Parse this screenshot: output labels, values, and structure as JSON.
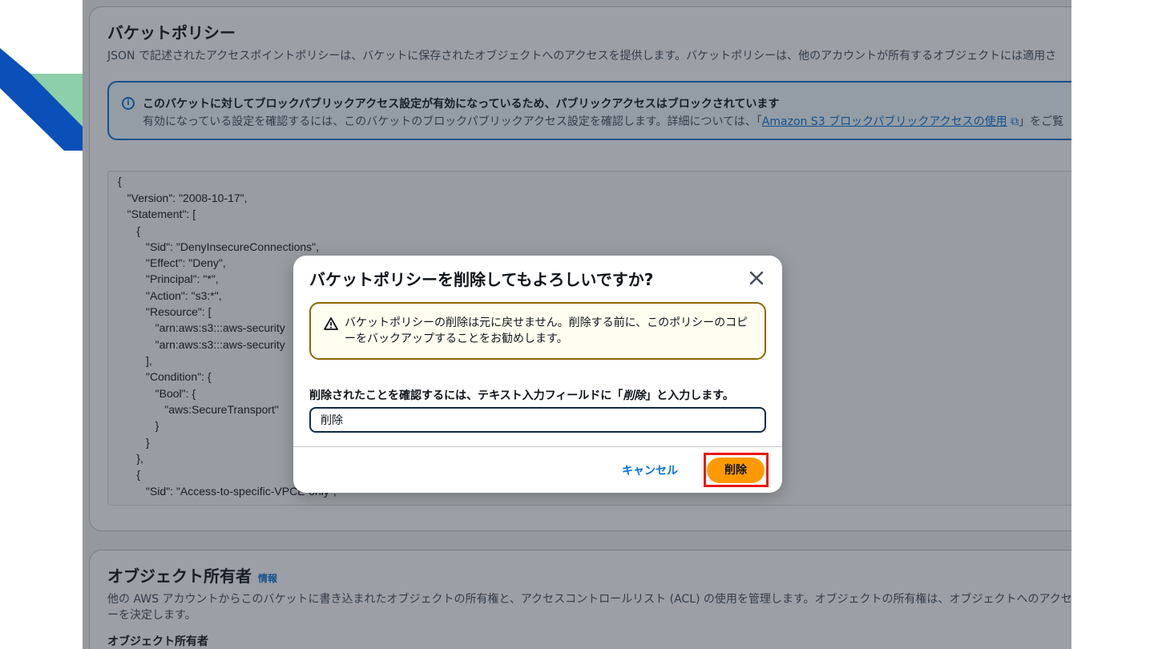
{
  "policy": {
    "title": "バケットポリシー",
    "description": "JSON で記述されたアクセスポイントポリシーは、バケットに保存されたオブジェクトへのアクセスを提供します。バケットポリシーは、他のアカウントが所有するオブジェクトには適用さ",
    "alert": {
      "heading": "このバケットに対してブロックパブリックアクセス設定が有効になっているため、パブリックアクセスはブロックされています",
      "body_prefix": "有効になっている設定を確認するには、このバケットのブロックパブリックアクセス設定を確認します。詳細については、「",
      "link": "Amazon S3 ブロックパブリックアクセスの使用",
      "body_suffix": "」をご覧"
    },
    "code_lines": [
      "{",
      "   \"Version\": \"2008-10-17\",",
      "   \"Statement\": [",
      "      {",
      "         \"Sid\": \"DenyInsecureConnections\",",
      "         \"Effect\": \"Deny\",",
      "         \"Principal\": \"*\",",
      "         \"Action\": \"s3:*\",",
      "         \"Resource\": [",
      "            \"arn:aws:s3:::aws-security",
      "            \"arn:aws:s3:::aws-security",
      "         ],",
      "         \"Condition\": {",
      "            \"Bool\": {",
      "               \"aws:SecureTransport\"",
      "            }",
      "         }",
      "      },",
      "      {",
      "         \"Sid\": \"Access-to-specific-VPCE-only\","
    ]
  },
  "owner": {
    "title": "オブジェクト所有者",
    "info": "情報",
    "description_line1": "他の AWS アカウントからこのバケットに書き込まれたオブジェクトの所有権と、アクセスコントロールリスト (ACL) の使用を管理します。オブジェクトの所有権は、オブジェクトへのアクセ",
    "description_line2": "ーを決定します。",
    "field_label": "オブジェクト所有者"
  },
  "modal": {
    "title": "バケットポリシーを削除してもよろしいですか?",
    "warning": "バケットポリシーの削除は元に戻せません。削除する前に、このポリシーのコピーをバックアップすることをお勧めします。",
    "confirm_prefix": "削除されたことを確認するには、テキスト入力フィールドに「",
    "confirm_keyword": "削除",
    "confirm_suffix": "」と入力します。",
    "input_value": "削除",
    "cancel_label": "キャンセル",
    "delete_label": "削除"
  },
  "colors": {
    "accent": "#0972d3",
    "primary_button": "#ff9900",
    "warning_border": "#8d6605",
    "highlight": "#e8190f"
  }
}
